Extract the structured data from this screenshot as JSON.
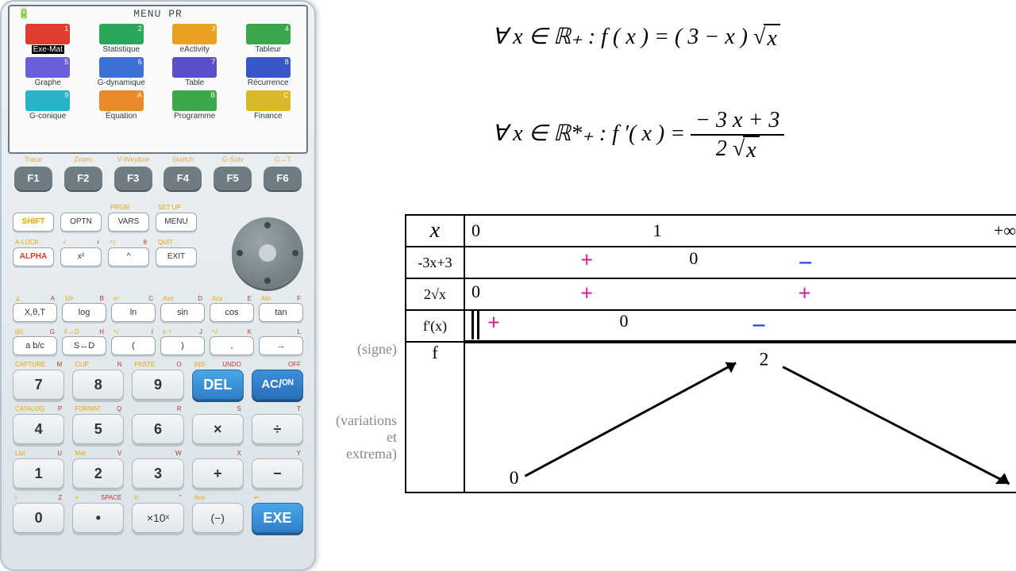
{
  "calculator": {
    "screen_title": "MENU PR",
    "menu": [
      {
        "label": "Exe-Mat",
        "num": "1",
        "color": "#e03d2e",
        "selected": true
      },
      {
        "label": "Statistique",
        "num": "2",
        "color": "#2aa85a"
      },
      {
        "label": "eActivity",
        "num": "3",
        "color": "#e8a01e"
      },
      {
        "label": "Tableur",
        "num": "4",
        "color": "#3aa84a"
      },
      {
        "label": "Graphe",
        "num": "5",
        "color": "#6a5fd8"
      },
      {
        "label": "G-dynamique",
        "num": "6",
        "color": "#3d6fd6"
      },
      {
        "label": "Table",
        "num": "7",
        "color": "#5b4fc9"
      },
      {
        "label": "Récurrence",
        "num": "8",
        "color": "#3758c9"
      },
      {
        "label": "G-conique",
        "num": "9",
        "color": "#27b4c9"
      },
      {
        "label": "Équation",
        "num": "A",
        "color": "#e98a2a"
      },
      {
        "label": "Programme",
        "num": "B",
        "color": "#3aa84a"
      },
      {
        "label": "Finance",
        "num": "C",
        "color": "#d9b82a"
      }
    ],
    "fkeys": [
      {
        "main": "F1",
        "sup": "Trace"
      },
      {
        "main": "F2",
        "sup": "Zoom"
      },
      {
        "main": "F3",
        "sup": "V-Window"
      },
      {
        "main": "F4",
        "sup": "Sketch"
      },
      {
        "main": "F5",
        "sup": "G-Solv"
      },
      {
        "main": "F6",
        "sup": "G↔T"
      }
    ],
    "mid": [
      [
        {
          "t": "SHIFT",
          "cls": "ylw"
        },
        {
          "t": "OPTN"
        },
        {
          "t": "VARS",
          "supL": "PRGM"
        },
        {
          "t": "MENU",
          "supL": "SET UP"
        }
      ],
      [
        {
          "t": "ALPHA",
          "cls": "red",
          "supL": "A-LOCK"
        },
        {
          "t": "x²",
          "supL": "√",
          "supR": "r"
        },
        {
          "t": "^",
          "supL": "ˣ√",
          "supR": "θ"
        },
        {
          "t": "EXIT",
          "supL": "QUIT"
        }
      ]
    ],
    "sci": [
      [
        {
          "t": "X,θ,T",
          "tl": "∠",
          "tr": "A"
        },
        {
          "t": "log",
          "tl": "10ˣ",
          "tr": "B"
        },
        {
          "t": "ln",
          "tl": "eˣ",
          "tr": "C"
        },
        {
          "t": "sin",
          "tl": "Asn",
          "tr": "D"
        },
        {
          "t": "cos",
          "tl": "Acs",
          "tr": "E"
        },
        {
          "t": "tan",
          "tl": "Atn",
          "tr": "F"
        }
      ],
      [
        {
          "t": "a b/c",
          "tl": "d/c",
          "tr": "G"
        },
        {
          "t": "S↔D",
          "tl": "F↔D",
          "tr": "H"
        },
        {
          "t": "(",
          "tl": "ᵌ√",
          "tr": "I"
        },
        {
          "t": ")",
          "tl": "x⁻¹",
          "tr": "J"
        },
        {
          "t": ",",
          "tl": "ˣ√",
          "tr": "K"
        },
        {
          "t": "→",
          "tl": "",
          "tr": "L"
        }
      ]
    ],
    "num": [
      [
        {
          "t": "7",
          "tl": "CAPTURE",
          "tr": "M"
        },
        {
          "t": "8",
          "tl": "CLIP",
          "tr": "N"
        },
        {
          "t": "9",
          "tl": "PASTE",
          "tr": "O"
        },
        {
          "t": "DEL",
          "cls": "blue",
          "tl": "INS",
          "tr": "UNDO"
        },
        {
          "t": "AC/ᴼᴺ",
          "cls": "blue2",
          "tl": "",
          "tr": "OFF"
        }
      ],
      [
        {
          "t": "4",
          "tl": "CATALOG",
          "tr": "P"
        },
        {
          "t": "5",
          "tl": "FORMAT",
          "tr": "Q"
        },
        {
          "t": "6",
          "tl": "",
          "tr": "R"
        },
        {
          "t": "×",
          "tl": "",
          "tr": "S"
        },
        {
          "t": "÷",
          "tl": "",
          "tr": "T"
        }
      ],
      [
        {
          "t": "1",
          "tl": "List",
          "tr": "U"
        },
        {
          "t": "2",
          "tl": "Mat",
          "tr": "V"
        },
        {
          "t": "3",
          "tl": "",
          "tr": "W"
        },
        {
          "t": "+",
          "tl": "",
          "tr": "X"
        },
        {
          "t": "−",
          "tl": "",
          "tr": "Y"
        }
      ],
      [
        {
          "t": "0",
          "tl": "i",
          "tr": "Z"
        },
        {
          "t": "•",
          "tl": "=",
          "tr": "SPACE"
        },
        {
          "t": "×10ˣ",
          "cls": "small",
          "tl": "π",
          "tr": "\""
        },
        {
          "t": "(−)",
          "cls": "small",
          "tl": "Ans",
          "tr": ""
        },
        {
          "t": "EXE",
          "cls": "blue",
          "tl": "↵",
          "tr": ""
        }
      ]
    ]
  },
  "formulas": {
    "f1_prefix": "∀ x ∈ ℝ₊ : ",
    "f1_func": "f ( x ) = ( 3 − x )",
    "f1_sqrt": "x",
    "f2_prefix": "∀ x ∈ ℝ*₊ : ",
    "f2_func": "f ′( x ) =",
    "f2_num": "− 3 x + 3",
    "f2_den_pre": "2",
    "f2_den_sqrt": "x"
  },
  "labels": {
    "signe": "(signe)",
    "variations": "(variations\net\nextrema)"
  },
  "table": {
    "x_header": "x",
    "x_vals": [
      "0",
      "1",
      "+∞"
    ],
    "rows": [
      {
        "hdr": "-3x+3",
        "cells": [
          "",
          "+",
          "0",
          "−",
          ""
        ]
      },
      {
        "hdr": "2√x",
        "cells": [
          "0",
          "+",
          "",
          "+",
          ""
        ]
      },
      {
        "hdr": "f'(x)",
        "cells": [
          "||",
          "+",
          "0",
          "−",
          ""
        ]
      }
    ],
    "f_hdr": "f",
    "f_start": "0",
    "f_max": "2"
  }
}
